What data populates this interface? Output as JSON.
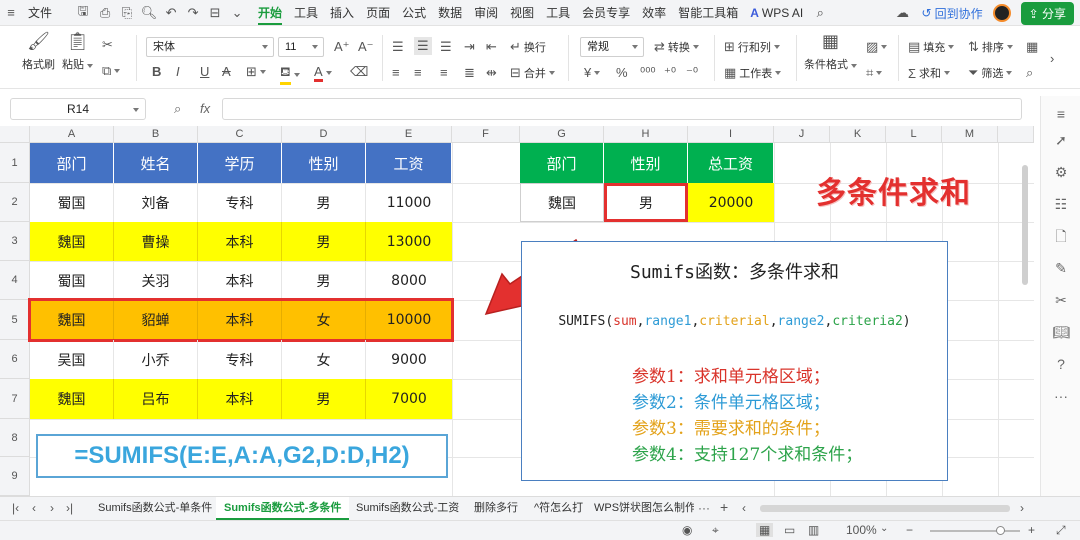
{
  "menu": {
    "file": "文件",
    "tabs": [
      "开始",
      "工具",
      "插入",
      "页面",
      "公式",
      "数据",
      "审阅",
      "视图",
      "工具",
      "会员专享",
      "效率",
      "智能工具箱"
    ],
    "active_tab": "开始",
    "wps_ai": "WPS AI",
    "collab": "回到协作",
    "share": "分享"
  },
  "ribbon": {
    "format_painter": "格式刷",
    "paste": "粘贴",
    "font": "宋体",
    "font_size": "11",
    "wrap": "换行",
    "merge": "合并",
    "number_format": "常规",
    "convert": "转换",
    "rows_cols": "行和列",
    "worksheet": "工作表",
    "conditional_format": "条件格式",
    "fill": "填充",
    "sort": "排序",
    "sum": "求和",
    "filter": "筛选"
  },
  "formula_bar": {
    "name_box": "R14",
    "fx": "fx"
  },
  "columns": [
    "A",
    "B",
    "C",
    "D",
    "E",
    "F",
    "G",
    "H",
    "I",
    "J",
    "K",
    "L",
    "M"
  ],
  "rows": [
    "1",
    "2",
    "3",
    "4",
    "5",
    "6",
    "7",
    "8",
    "9"
  ],
  "main_table": {
    "headers": [
      "部门",
      "姓名",
      "学历",
      "性别",
      "工资"
    ],
    "rows": [
      [
        "蜀国",
        "刘备",
        "专科",
        "男",
        "11000"
      ],
      [
        "魏国",
        "曹操",
        "本科",
        "男",
        "13000"
      ],
      [
        "蜀国",
        "关羽",
        "本科",
        "男",
        "8000"
      ],
      [
        "魏国",
        "貂蝉",
        "本科",
        "女",
        "10000"
      ],
      [
        "吴国",
        "小乔",
        "专科",
        "女",
        "9000"
      ],
      [
        "魏国",
        "吕布",
        "本科",
        "男",
        "7000"
      ]
    ]
  },
  "criteria_table": {
    "headers": [
      "部门",
      "性别",
      "总工资"
    ],
    "values": [
      "魏国",
      "男",
      "20000"
    ]
  },
  "big_title": "多条件求和",
  "formula_display": "=SUMIFS(E:E,A:A,G2,D:D,H2)",
  "info": {
    "title": "Sumifs函数：多条件求和",
    "syntax_fn": "SUMIFS(",
    "syntax_sum": "sum",
    "syntax_range1": "range1",
    "syntax_criterial": "criterial",
    "syntax_range2": "range2",
    "syntax_criteria2": "criteria2",
    "syntax_close": ")",
    "params": [
      {
        "text": "参数1：求和单元格区域；",
        "color": "#d9342b"
      },
      {
        "text": "参数2：条件单元格区域；",
        "color": "#2e9bd6"
      },
      {
        "text": "参数3：需要求和的条件；",
        "color": "#e3a21a"
      },
      {
        "text": "参数4：支持127个求和条件；",
        "color": "#2ca34a"
      }
    ]
  },
  "sheet_tabs": [
    "Sumifs函数公式-单条件",
    "Sumifs函数公式-多条件",
    "Sumifs函数公式-工资",
    "删除多行",
    "^符怎么打",
    "WPS饼状图怎么制作百分"
  ],
  "active_sheet": "Sumifs函数公式-多条件",
  "status": {
    "zoom": "100%"
  },
  "colors": {
    "header_blue": "#4472c4",
    "highlight_yellow": "#ffff00",
    "highlight_orange": "#ffc000",
    "criteria_green": "#00b050",
    "accent_red": "#e3302f",
    "brand_green": "#1a9c3e"
  }
}
